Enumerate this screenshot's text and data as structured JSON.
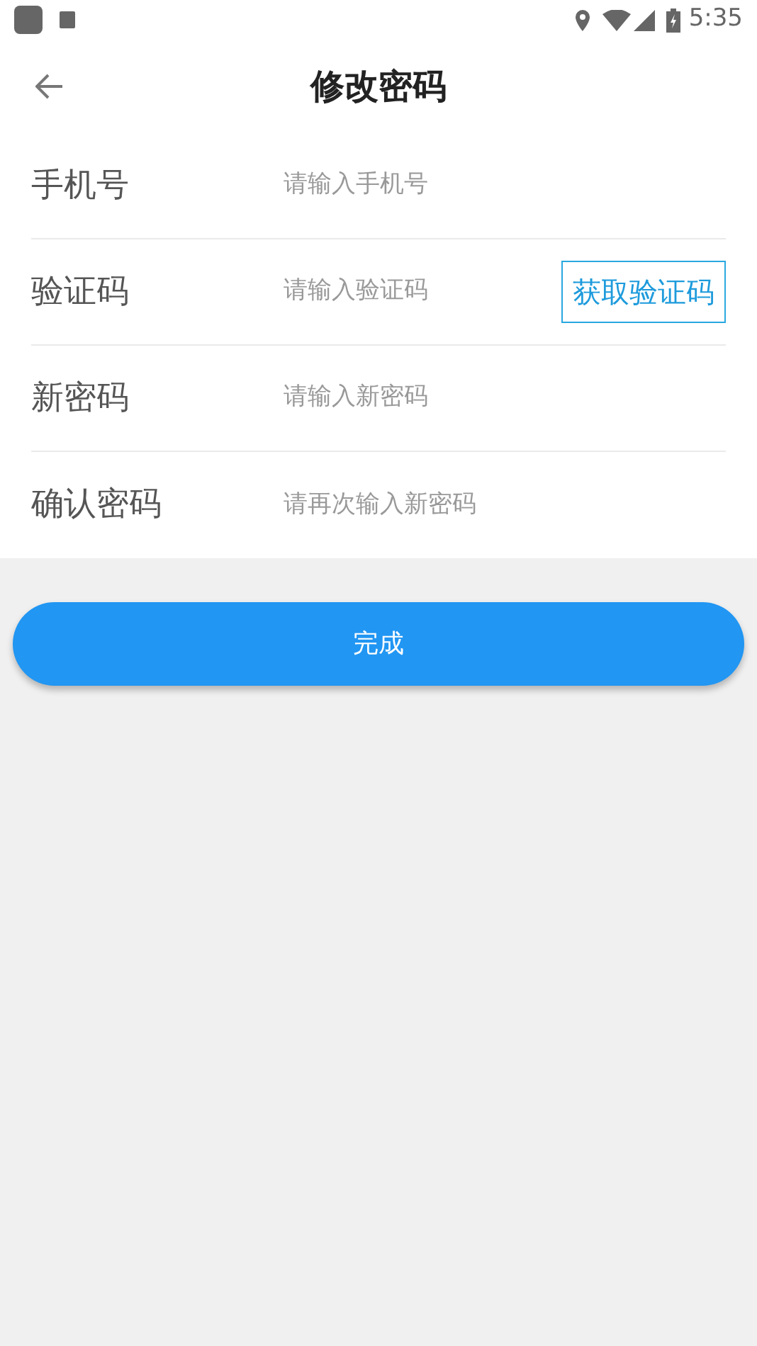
{
  "status_bar": {
    "time": "5:35"
  },
  "header": {
    "title": "修改密码"
  },
  "fields": [
    {
      "kind": "plain",
      "label": "手机号",
      "placeholder": "请输入手机号"
    },
    {
      "kind": "with_button",
      "label": "验证码",
      "placeholder": "请输入验证码",
      "button": "获取验证码"
    },
    {
      "kind": "plain",
      "label": "新密码",
      "placeholder": "请输入新密码"
    },
    {
      "kind": "plain",
      "label": "确认密码",
      "placeholder": "请再次输入新密码"
    }
  ],
  "submit_button": "完成"
}
